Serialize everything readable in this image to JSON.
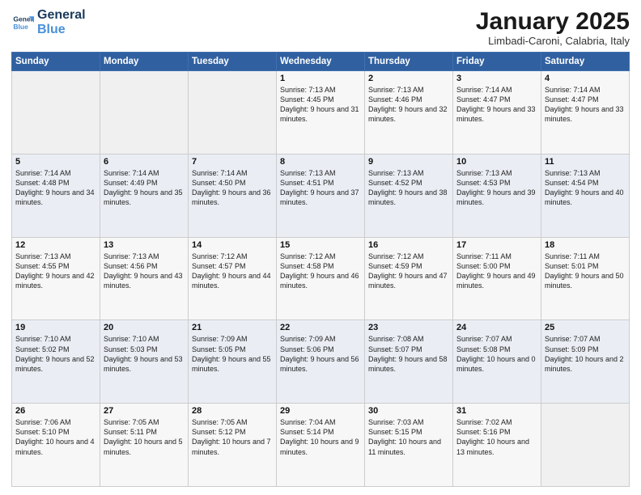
{
  "header": {
    "logo_line1": "General",
    "logo_line2": "Blue",
    "month_title": "January 2025",
    "location": "Limbadi-Caroni, Calabria, Italy"
  },
  "weekdays": [
    "Sunday",
    "Monday",
    "Tuesday",
    "Wednesday",
    "Thursday",
    "Friday",
    "Saturday"
  ],
  "weeks": [
    [
      {
        "day": "",
        "info": ""
      },
      {
        "day": "",
        "info": ""
      },
      {
        "day": "",
        "info": ""
      },
      {
        "day": "1",
        "info": "Sunrise: 7:13 AM\nSunset: 4:45 PM\nDaylight: 9 hours and 31 minutes."
      },
      {
        "day": "2",
        "info": "Sunrise: 7:13 AM\nSunset: 4:46 PM\nDaylight: 9 hours and 32 minutes."
      },
      {
        "day": "3",
        "info": "Sunrise: 7:14 AM\nSunset: 4:47 PM\nDaylight: 9 hours and 33 minutes."
      },
      {
        "day": "4",
        "info": "Sunrise: 7:14 AM\nSunset: 4:47 PM\nDaylight: 9 hours and 33 minutes."
      }
    ],
    [
      {
        "day": "5",
        "info": "Sunrise: 7:14 AM\nSunset: 4:48 PM\nDaylight: 9 hours and 34 minutes."
      },
      {
        "day": "6",
        "info": "Sunrise: 7:14 AM\nSunset: 4:49 PM\nDaylight: 9 hours and 35 minutes."
      },
      {
        "day": "7",
        "info": "Sunrise: 7:14 AM\nSunset: 4:50 PM\nDaylight: 9 hours and 36 minutes."
      },
      {
        "day": "8",
        "info": "Sunrise: 7:13 AM\nSunset: 4:51 PM\nDaylight: 9 hours and 37 minutes."
      },
      {
        "day": "9",
        "info": "Sunrise: 7:13 AM\nSunset: 4:52 PM\nDaylight: 9 hours and 38 minutes."
      },
      {
        "day": "10",
        "info": "Sunrise: 7:13 AM\nSunset: 4:53 PM\nDaylight: 9 hours and 39 minutes."
      },
      {
        "day": "11",
        "info": "Sunrise: 7:13 AM\nSunset: 4:54 PM\nDaylight: 9 hours and 40 minutes."
      }
    ],
    [
      {
        "day": "12",
        "info": "Sunrise: 7:13 AM\nSunset: 4:55 PM\nDaylight: 9 hours and 42 minutes."
      },
      {
        "day": "13",
        "info": "Sunrise: 7:13 AM\nSunset: 4:56 PM\nDaylight: 9 hours and 43 minutes."
      },
      {
        "day": "14",
        "info": "Sunrise: 7:12 AM\nSunset: 4:57 PM\nDaylight: 9 hours and 44 minutes."
      },
      {
        "day": "15",
        "info": "Sunrise: 7:12 AM\nSunset: 4:58 PM\nDaylight: 9 hours and 46 minutes."
      },
      {
        "day": "16",
        "info": "Sunrise: 7:12 AM\nSunset: 4:59 PM\nDaylight: 9 hours and 47 minutes."
      },
      {
        "day": "17",
        "info": "Sunrise: 7:11 AM\nSunset: 5:00 PM\nDaylight: 9 hours and 49 minutes."
      },
      {
        "day": "18",
        "info": "Sunrise: 7:11 AM\nSunset: 5:01 PM\nDaylight: 9 hours and 50 minutes."
      }
    ],
    [
      {
        "day": "19",
        "info": "Sunrise: 7:10 AM\nSunset: 5:02 PM\nDaylight: 9 hours and 52 minutes."
      },
      {
        "day": "20",
        "info": "Sunrise: 7:10 AM\nSunset: 5:03 PM\nDaylight: 9 hours and 53 minutes."
      },
      {
        "day": "21",
        "info": "Sunrise: 7:09 AM\nSunset: 5:05 PM\nDaylight: 9 hours and 55 minutes."
      },
      {
        "day": "22",
        "info": "Sunrise: 7:09 AM\nSunset: 5:06 PM\nDaylight: 9 hours and 56 minutes."
      },
      {
        "day": "23",
        "info": "Sunrise: 7:08 AM\nSunset: 5:07 PM\nDaylight: 9 hours and 58 minutes."
      },
      {
        "day": "24",
        "info": "Sunrise: 7:07 AM\nSunset: 5:08 PM\nDaylight: 10 hours and 0 minutes."
      },
      {
        "day": "25",
        "info": "Sunrise: 7:07 AM\nSunset: 5:09 PM\nDaylight: 10 hours and 2 minutes."
      }
    ],
    [
      {
        "day": "26",
        "info": "Sunrise: 7:06 AM\nSunset: 5:10 PM\nDaylight: 10 hours and 4 minutes."
      },
      {
        "day": "27",
        "info": "Sunrise: 7:05 AM\nSunset: 5:11 PM\nDaylight: 10 hours and 5 minutes."
      },
      {
        "day": "28",
        "info": "Sunrise: 7:05 AM\nSunset: 5:12 PM\nDaylight: 10 hours and 7 minutes."
      },
      {
        "day": "29",
        "info": "Sunrise: 7:04 AM\nSunset: 5:14 PM\nDaylight: 10 hours and 9 minutes."
      },
      {
        "day": "30",
        "info": "Sunrise: 7:03 AM\nSunset: 5:15 PM\nDaylight: 10 hours and 11 minutes."
      },
      {
        "day": "31",
        "info": "Sunrise: 7:02 AM\nSunset: 5:16 PM\nDaylight: 10 hours and 13 minutes."
      },
      {
        "day": "",
        "info": ""
      }
    ]
  ]
}
